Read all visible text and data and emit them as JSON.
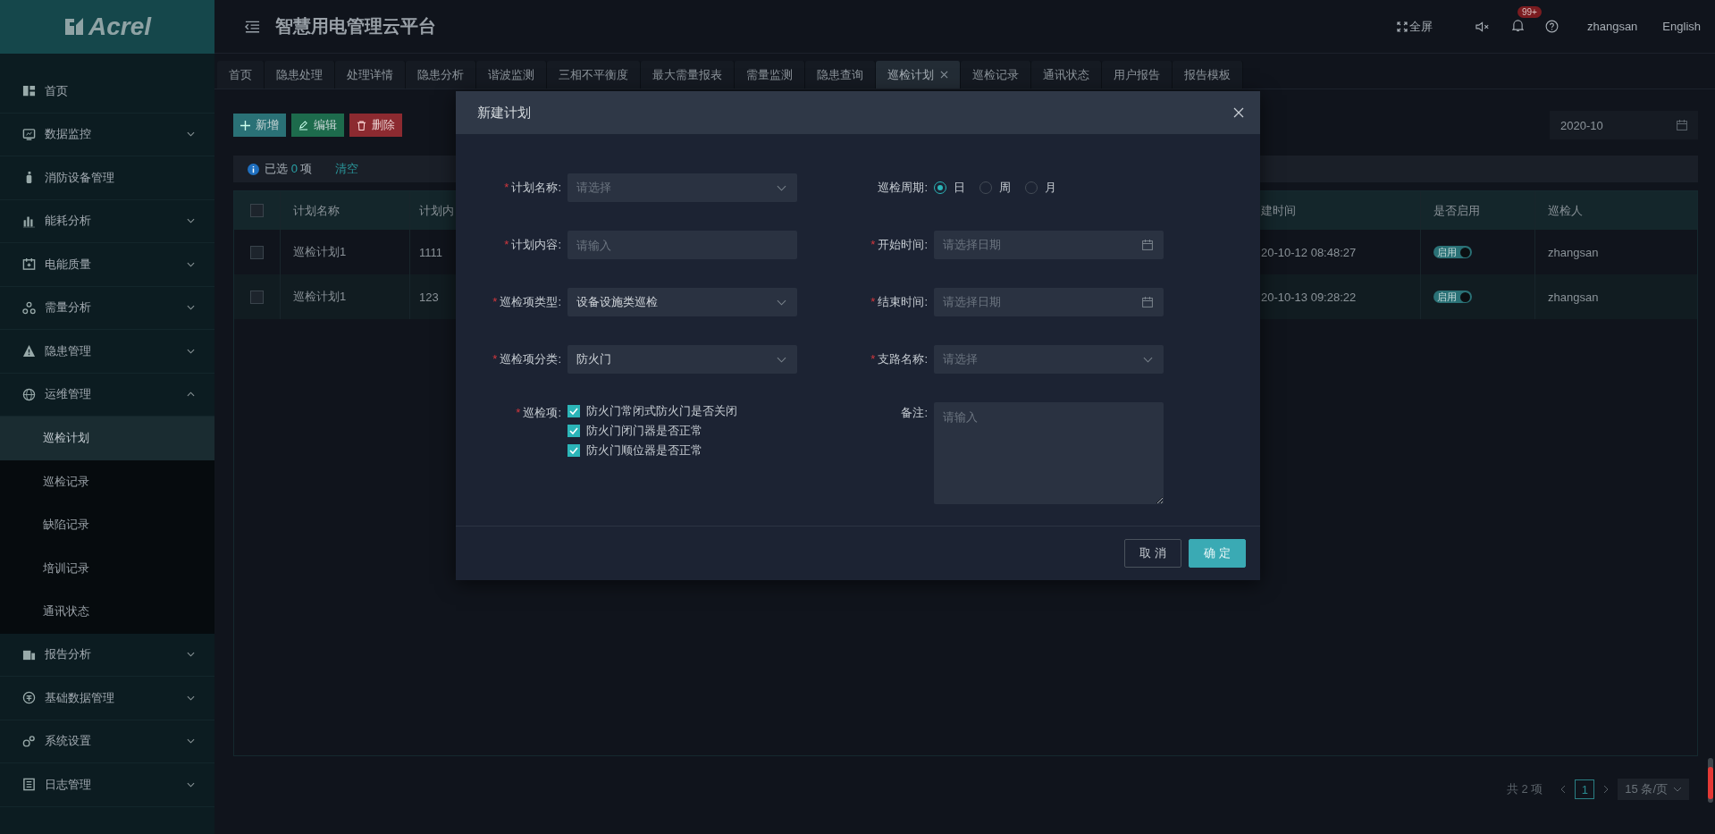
{
  "logo": {
    "text": "Acrel"
  },
  "header": {
    "title": "智慧用电管理云平台",
    "fullscreen": "全屏",
    "badge": "99+",
    "user": "zhangsan",
    "language": "English"
  },
  "sidebar": {
    "items": [
      {
        "label": "首页",
        "kind": "link",
        "selected": false
      },
      {
        "label": "数据监控",
        "kind": "group",
        "expanded": false,
        "selected": false
      },
      {
        "label": "消防设备管理",
        "kind": "link",
        "selected": false
      },
      {
        "label": "能耗分析",
        "kind": "group",
        "expanded": false,
        "selected": false
      },
      {
        "label": "电能质量",
        "kind": "group",
        "expanded": false,
        "selected": false
      },
      {
        "label": "需量分析",
        "kind": "group",
        "expanded": false,
        "selected": false
      },
      {
        "label": "隐患管理",
        "kind": "group",
        "expanded": false,
        "selected": false
      },
      {
        "label": "运维管理",
        "kind": "group",
        "expanded": true,
        "selected": false,
        "children": [
          {
            "label": "巡检计划",
            "selected": true
          },
          {
            "label": "巡检记录",
            "selected": false
          },
          {
            "label": "缺陷记录",
            "selected": false
          },
          {
            "label": "培训记录",
            "selected": false
          },
          {
            "label": "通讯状态",
            "selected": false
          }
        ]
      },
      {
        "label": "报告分析",
        "kind": "group",
        "expanded": false,
        "selected": false
      },
      {
        "label": "基础数据管理",
        "kind": "group",
        "expanded": false,
        "selected": false
      },
      {
        "label": "系统设置",
        "kind": "group",
        "expanded": false,
        "selected": false
      },
      {
        "label": "日志管理",
        "kind": "group",
        "expanded": false,
        "selected": false
      }
    ]
  },
  "tabs": [
    {
      "label": "首页",
      "selected": false
    },
    {
      "label": "隐患处理",
      "selected": false
    },
    {
      "label": "处理详情",
      "selected": false
    },
    {
      "label": "隐患分析",
      "selected": false
    },
    {
      "label": "谐波监测",
      "selected": false
    },
    {
      "label": "三相不平衡度",
      "selected": false
    },
    {
      "label": "最大需量报表",
      "selected": false
    },
    {
      "label": "需量监测",
      "selected": false
    },
    {
      "label": "隐患查询",
      "selected": false
    },
    {
      "label": "巡检计划",
      "selected": true
    },
    {
      "label": "巡检记录",
      "selected": false
    },
    {
      "label": "通讯状态",
      "selected": false
    },
    {
      "label": "用户报告",
      "selected": false
    },
    {
      "label": "报告模板",
      "selected": false
    }
  ],
  "toolbar": {
    "buttons": [
      {
        "label": "新增",
        "kind": "add"
      },
      {
        "label": "编辑",
        "kind": "edit"
      },
      {
        "label": "删除",
        "kind": "delete"
      }
    ],
    "month": "2020-10"
  },
  "selection": {
    "prefix": "已选",
    "count": "0",
    "suffix": "项",
    "clear": "清空"
  },
  "table": {
    "all_checked": false,
    "columns": [
      "计划名称",
      "计划内",
      "建时间",
      "是否启用",
      "巡检人"
    ],
    "rows": [
      {
        "checked": false,
        "cells": [
          "巡检计划1",
          "1111",
          "20-10-12 08:48:27"
        ],
        "toggle": {
          "label": "启用",
          "on": true
        },
        "inspector": "zhangsan"
      },
      {
        "checked": false,
        "cells": [
          "巡检计划1",
          "123",
          "20-10-13 09:28:22"
        ],
        "toggle": {
          "label": "启用",
          "on": true
        },
        "inspector": "zhangsan"
      }
    ]
  },
  "pagination": {
    "total": "共 2 项",
    "pages": [
      {
        "label": "1",
        "selected": true
      }
    ],
    "page_size": "15 条/页"
  },
  "dialog": {
    "title": "新建计划",
    "fields": [
      {
        "label": "计划名称:",
        "mark": "*",
        "kind": "select",
        "placeholder": "请选择"
      },
      {
        "label": "巡检周期:",
        "kind": "radio",
        "options": [
          {
            "label": "日",
            "selected": true
          },
          {
            "label": "周",
            "selected": false
          },
          {
            "label": "月",
            "selected": false
          }
        ]
      },
      {
        "label": "计划内容:",
        "mark": "*",
        "kind": "input",
        "placeholder": "请输入"
      },
      {
        "label": "开始时间:",
        "mark": "*",
        "kind": "date",
        "placeholder": "请选择日期"
      },
      {
        "label": "巡检项类型:",
        "mark": "*",
        "kind": "select",
        "value": "设备设施类巡检"
      },
      {
        "label": "结束时间:",
        "mark": "*",
        "kind": "date",
        "placeholder": "请选择日期"
      },
      {
        "label": "巡检项分类:",
        "mark": "*",
        "kind": "select",
        "value": "防火门"
      },
      {
        "label": "支路名称:",
        "mark": "*",
        "kind": "select",
        "placeholder": "请选择"
      },
      {
        "label": "巡检项:",
        "mark": "*",
        "kind": "checks",
        "options": [
          {
            "label": "防火门常闭式防火门是否关闭",
            "checked": true
          },
          {
            "label": "防火门闭门器是否正常",
            "checked": true
          },
          {
            "label": "防火门顺位器是否正常",
            "checked": true
          }
        ]
      },
      {
        "label": "备注:",
        "kind": "textarea",
        "placeholder": "请输入"
      }
    ],
    "buttons": [
      {
        "label": "取 消",
        "kind": "cancel"
      },
      {
        "label": "确 定",
        "kind": "confirm"
      }
    ]
  }
}
